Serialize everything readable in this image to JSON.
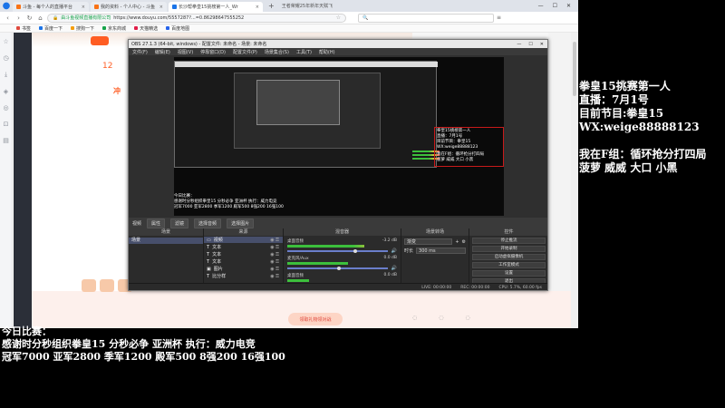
{
  "browser": {
    "tabs": [
      {
        "title": "斗鱼 - 每个人的直播平台"
      },
      {
        "title": "我的资料 - 个人中心 - 斗鱼"
      },
      {
        "title": "长沙帮拳皇15挑榜第一人_Wr"
      }
    ],
    "tab_search": "王者荣耀25年新年天赋飞"
  },
  "toolbar": {
    "url": "https://www.douyu.com/5557287?...=0.86298647555252",
    "url_secure_label": "由斗鱼视频直播有限公司"
  },
  "bookmarks": [
    "书签",
    "百度一下",
    "搜狗一下",
    "京东商城",
    "天猫精选",
    "百度地图"
  ],
  "page": {
    "banner_number": "12",
    "banner_text": "冲",
    "bottom_cta": "领取礼物领对战"
  },
  "obs": {
    "title": "OBS 27.1.3 (64-bit, windows) - 配置文件: 未命名 - 场景: 未命名",
    "menu": [
      "文件(F)",
      "编辑(E)",
      "视图(V)",
      "停靠窗口(D)",
      "配置文件(P)",
      "场景集合(S)",
      "工具(T)",
      "帮助(H)"
    ],
    "preview_overlay_right": [
      "拳皇15挑榜第一人",
      "直播：7月1号",
      "目前节目：拳皇15",
      "WX:weige88888123",
      "",
      "我在F组：循环抢分打四局",
      "菠萝 威威 大口 小黑"
    ],
    "preview_overlay_bottom": [
      "今日比赛：",
      "感谢时分秒组织拳皇15 分秒必争 亚洲杯 执行：威力电竞",
      "冠军7000 亚军2800 季军1200 殿军500 8强200 16强100"
    ],
    "scene_bar": {
      "current": "视频",
      "buttons": [
        "属性",
        "滤镜",
        "选择音频",
        "选择图片"
      ]
    },
    "docks": {
      "scenes": {
        "title": "场景",
        "items": [
          "场景"
        ]
      },
      "sources": {
        "title": "来源",
        "items": [
          "视频",
          "文本",
          "文本",
          "文本",
          "图片",
          "比分样"
        ]
      },
      "mixer": {
        "title": "混音器",
        "channels": [
          {
            "name": "桌面音频",
            "db": "-3.2 dB",
            "level": 0.7
          },
          {
            "name": "麦克风/Aux",
            "db": "0.0 dB",
            "level": 0.55
          },
          {
            "name": "桌面音频",
            "db": "0.0 dB",
            "level": 0.2
          }
        ]
      },
      "transitions": {
        "title": "场景转场",
        "selected": "渐变",
        "duration_label": "时长",
        "duration": "300 ms"
      },
      "controls": {
        "title": "控件",
        "buttons": [
          "停止推流",
          "开始录制",
          "启动虚拟摄像机",
          "工作室模式",
          "设置",
          "退出"
        ]
      }
    },
    "status": [
      "LIVE: 00:00:00",
      "REC: 00:00:00",
      "CPU: 5.7%, 60.00 fps"
    ]
  },
  "overlay": {
    "right_lines": [
      "拳皇15挑赛第一人",
      "直播：7月1号",
      "目前节目:拳皇15",
      "WX:weige88888123"
    ],
    "right_lines_2": [
      "我在F组：循环抢分打四局",
      "菠萝 威威 大口 小黑"
    ],
    "bottom_lines": [
      "今日比赛：",
      "感谢时分秒组织拳皇15 分秒必争 亚洲杯 执行：威力电竞",
      "冠军7000 亚军2800 季军1200 殿军500 8强200 16强100"
    ]
  }
}
